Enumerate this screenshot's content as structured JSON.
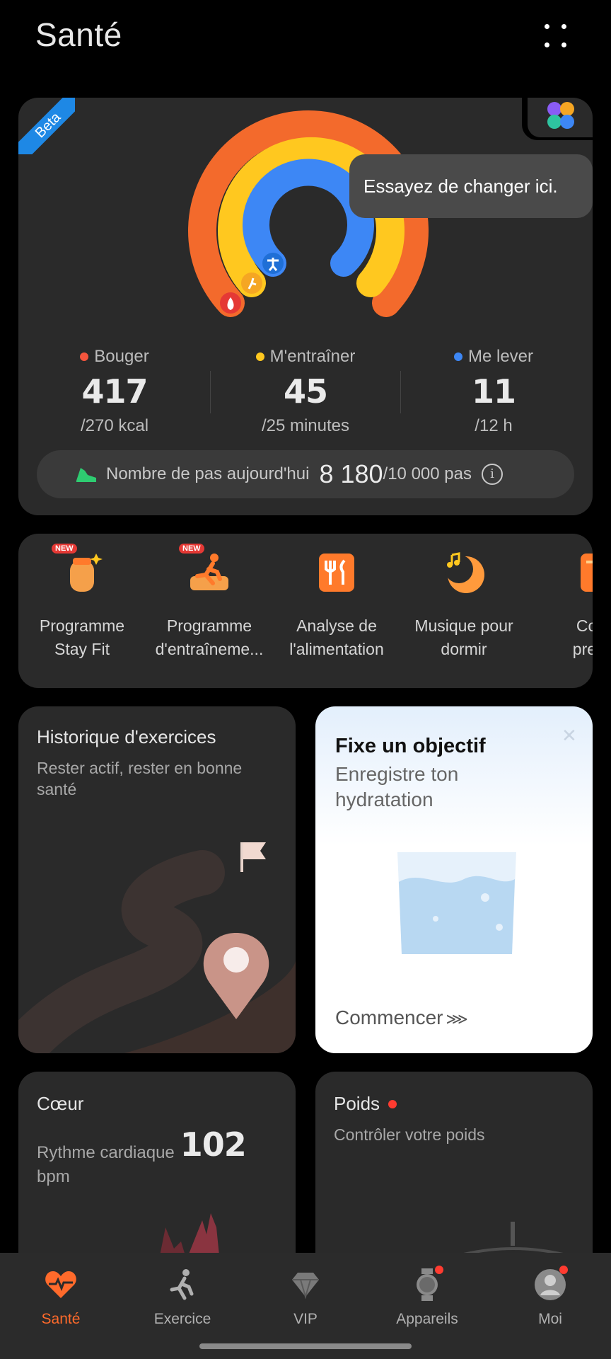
{
  "header": {
    "title": "Santé"
  },
  "activity": {
    "beta_label": "Beta",
    "tooltip": "Essayez de changer ici.",
    "stats": [
      {
        "label": "Bouger",
        "value": "417",
        "goal": "/270 kcal",
        "color": "#f5553d"
      },
      {
        "label": "M'entraîner",
        "value": "45",
        "goal": "/25 minutes",
        "color": "#ffc81f"
      },
      {
        "label": "Me lever",
        "value": "11",
        "goal": "/12 h",
        "color": "#3d87f5"
      }
    ],
    "steps": {
      "label": "Nombre de pas aujourd'hui",
      "value": "8 180",
      "goal": "/10 000 pas"
    }
  },
  "shortcuts": [
    {
      "label_line1": "Programme",
      "label_line2": "Stay Fit",
      "badge": "NEW"
    },
    {
      "label_line1": "Programme",
      "label_line2": "d'entraîneme...",
      "badge": "NEW"
    },
    {
      "label_line1": "Analyse de",
      "label_line2": "l'alimentation"
    },
    {
      "label_line1": "Musique pour",
      "label_line2": "dormir"
    },
    {
      "label_line1": "Cou",
      "label_line2": "prem"
    }
  ],
  "exercise_history": {
    "title": "Historique d'exercices",
    "subtitle": "Rester actif, rester en bonne santé"
  },
  "goal_card": {
    "title": "Fixe un objectif",
    "subtitle": "Enregistre ton hydratation",
    "cta": "Commencer",
    "cta_arrow": "⋙"
  },
  "heart": {
    "title": "Cœur",
    "label": "Rythme cardiaque",
    "value": "102",
    "unit": "bpm"
  },
  "weight": {
    "title": "Poids",
    "subtitle": "Contrôler votre poids"
  },
  "nav": [
    {
      "label": "Santé",
      "active": true
    },
    {
      "label": "Exercice"
    },
    {
      "label": "VIP"
    },
    {
      "label": "Appareils"
    },
    {
      "label": "Moi"
    }
  ],
  "colors": {
    "accent": "#ff6a2b",
    "move": "#f5553d",
    "exercise": "#ffc81f",
    "stand": "#3d87f5"
  }
}
